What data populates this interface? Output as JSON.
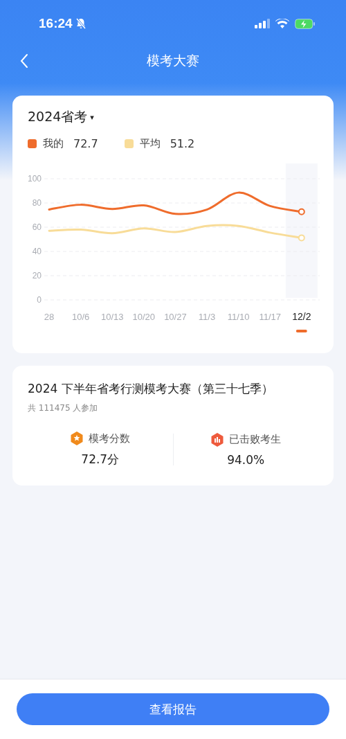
{
  "status_bar": {
    "time": "16:24"
  },
  "nav": {
    "title": "模考大赛"
  },
  "trend_card": {
    "exam_selector": "2024省考",
    "dropdown_marker": "▾",
    "legend": [
      {
        "value": "72.7"
      },
      {
        "value": "51.2"
      }
    ],
    "chart_data": {
      "type": "line",
      "grid": true,
      "categories": [
        "28",
        "10/6",
        "10/13",
        "10/20",
        "10/27",
        "11/3",
        "11/10",
        "11/17",
        "12/2"
      ],
      "series": [
        {
          "name": "我的",
          "color": "#ef6c2c",
          "values": [
            74.6,
            78.5,
            75,
            78,
            71,
            74.5,
            88.5,
            77.5,
            72.7
          ]
        },
        {
          "name": "平均",
          "color": "#f8dc98",
          "values": [
            57,
            58,
            55,
            59,
            56,
            61,
            61,
            55.5,
            51.2
          ]
        }
      ],
      "ylim": [
        0,
        100
      ],
      "yticks": [
        0,
        20,
        40,
        60,
        80,
        100
      ],
      "annotations": [
        {
          "x": "12/2"
        }
      ]
    }
  },
  "contest_card": {
    "title": "2024 下半年省考行测模考大赛（第三十七季）",
    "participants": "共 111475 人参加",
    "stats": [
      {
        "kind": "score",
        "label": "模考分数",
        "value": "72.7分"
      },
      {
        "kind": "rank",
        "label": "已击败考生",
        "value": "94.0%"
      }
    ]
  },
  "bottom_button": {
    "label": "查看报告"
  }
}
